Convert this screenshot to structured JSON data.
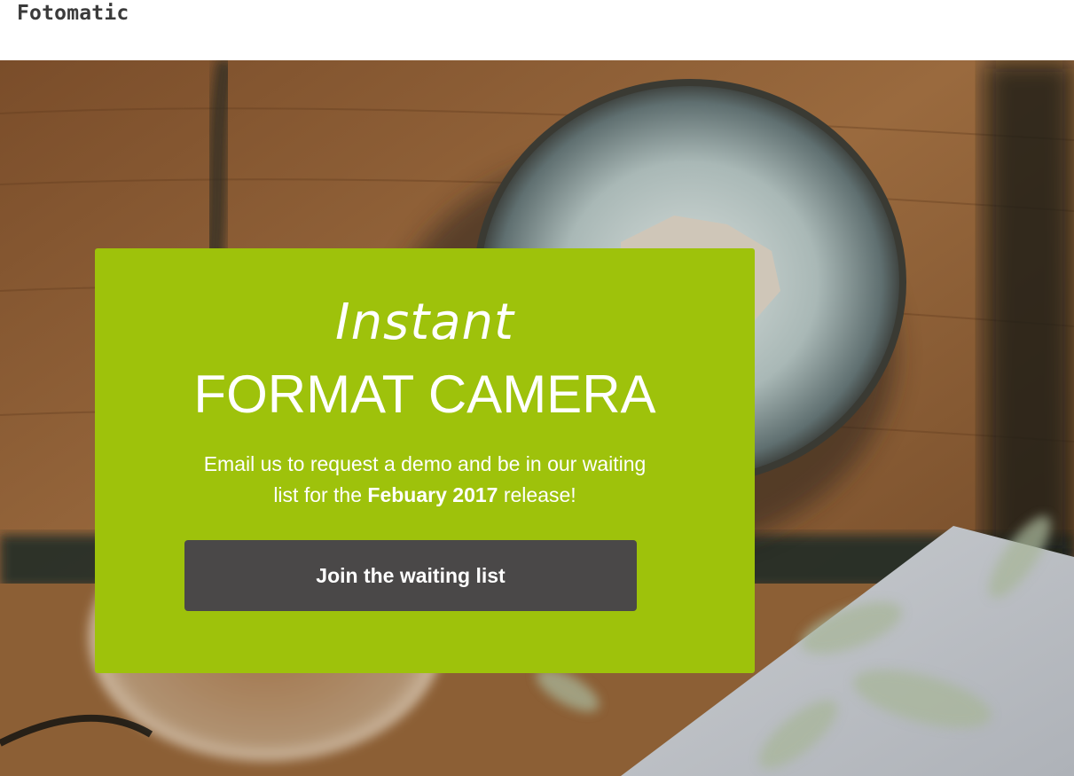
{
  "header": {
    "logo_text": "Fotomatic"
  },
  "hero": {
    "headline_script": "Instant",
    "headline_main": "FORMAT CAMERA",
    "description_before": "Email us to request a demo and be in our waiting list for the ",
    "description_highlight": "Febuary 2017",
    "description_after": " release!",
    "cta_label": "Join the waiting list"
  },
  "colors": {
    "card_background": "#9ec20b",
    "button_background": "#4a4848",
    "text_on_card": "#ffffff",
    "logo_text": "#3b3b3b"
  }
}
